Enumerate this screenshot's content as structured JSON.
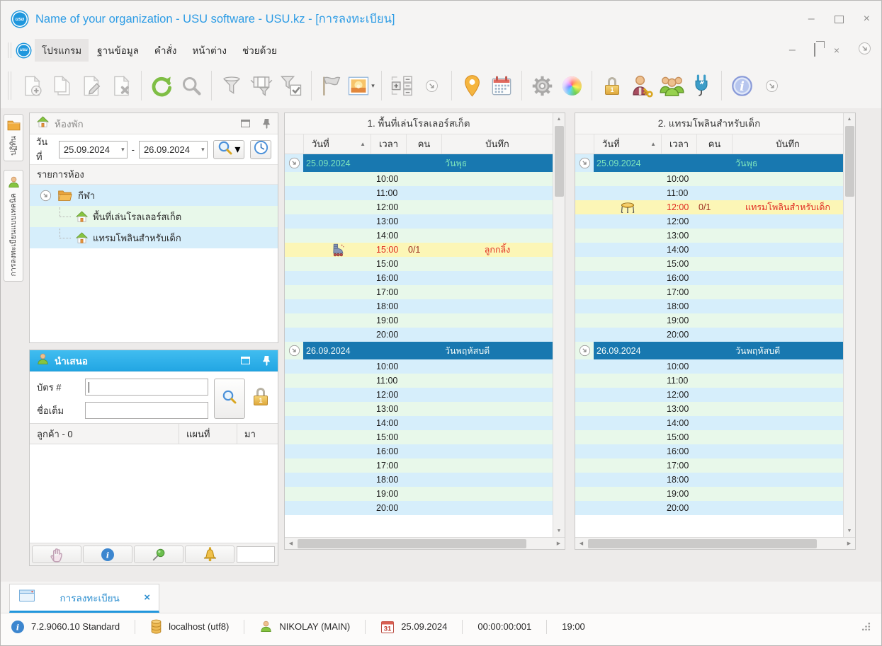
{
  "colors": {
    "accent_blue": "#2d9ce5",
    "group_header_blue": "#1878b0",
    "group1_text": "#7de4bc",
    "group2_text": "#f2fbf8",
    "booked_yellow": "#fcf6b6",
    "booked_red": "#e02b20",
    "booked_capacity_red": "#9c2d20",
    "row_green": "#e8f8ea",
    "row_blue": "#d6eefb"
  },
  "window": {
    "title": "Name of your organization - USU software - USU.kz - [การลงทะเบียน]",
    "logo_text": "usu"
  },
  "menu": {
    "items": [
      "โปรแกรม",
      "ฐานข้อมูล",
      "คำสั่ง",
      "หน้าต่าง",
      "ช่วยด้วย"
    ],
    "active_item": "โปรแกรม"
  },
  "toolbar": {
    "groups": [
      [
        "new-record-icon",
        "copy-record-icon",
        "edit-record-icon",
        "delete-record-icon"
      ],
      [
        "refresh-icon",
        "search-icon"
      ],
      [
        "filter-icon",
        "filter-columns-icon",
        "filter-check-icon"
      ],
      [
        "flag-icon",
        "image-picker-icon"
      ],
      [
        "row-expand-icon",
        "overflow-chevron-icon"
      ],
      [
        "location-pin-icon",
        "calendar-icon"
      ],
      [
        "settings-gear-icon",
        "color-wheel-icon"
      ],
      [
        "lock-icon",
        "user-key-icon",
        "users-group-icon",
        "plug-icon"
      ],
      [
        "info-icon",
        "overflow-chevron-icon"
      ]
    ]
  },
  "side_tabs": [
    {
      "icon": "folder-icon",
      "label": "ปฏิทิน"
    },
    {
      "icon": "person-icon",
      "label": "การลงทะเบียนแบบเทคนิค"
    }
  ],
  "rooms_panel": {
    "title": "ห้องพัก",
    "date_label": "วันที่",
    "date_from": "25.09.2024",
    "date_to": "26.09.2024",
    "date_separator": "-",
    "list_header": "รายการห้อง",
    "tree": [
      {
        "label": "กีฬา",
        "icon": "folder-open-icon",
        "expander": true,
        "shade": "blue"
      },
      {
        "label": "พื้นที่เล่นโรลเลอร์สเก็ต",
        "icon": "home-icon",
        "shade": "green",
        "child": true
      },
      {
        "label": "แทรมโพลินสำหรับเด็ก",
        "icon": "home-icon",
        "shade": "blue",
        "child": true
      }
    ]
  },
  "present_panel": {
    "title": "นำเสนอ",
    "fields": [
      {
        "label": "บัตร #",
        "value": ""
      },
      {
        "label": "ชื่อเต็ม",
        "value": ""
      }
    ],
    "table_headers": [
      "ลูกค้า - 0",
      "แผนที่",
      "มา"
    ],
    "footer_buttons": [
      "hand-icon",
      "info-blue-icon",
      "pushpin-icon",
      "bell-icon"
    ]
  },
  "schedules": [
    {
      "title": "1. พื้นที่เล่นโรลเลอร์สเก็ต",
      "columns": [
        "วันที่",
        "เวลา",
        "คน",
        "บันทึก"
      ],
      "groups": [
        {
          "date": "25.09.2024",
          "day": "วันพุธ",
          "text_color": "#7de4bc",
          "gutter_shade": "blue",
          "rows": [
            {
              "time": "10:00",
              "shade": "green"
            },
            {
              "time": "11:00",
              "shade": "blue"
            },
            {
              "time": "12:00",
              "shade": "green"
            },
            {
              "time": "13:00",
              "shade": "blue"
            },
            {
              "time": "14:00",
              "shade": "green"
            },
            {
              "time": "15:00",
              "people": "0/1",
              "note": "ลูกกลิ้ง",
              "booked": true,
              "icon": "roller-skate-icon"
            },
            {
              "time": "15:00",
              "shade": "green"
            },
            {
              "time": "16:00",
              "shade": "blue"
            },
            {
              "time": "17:00",
              "shade": "green"
            },
            {
              "time": "18:00",
              "shade": "blue"
            },
            {
              "time": "19:00",
              "shade": "green"
            },
            {
              "time": "20:00",
              "shade": "blue"
            }
          ]
        },
        {
          "date": "26.09.2024",
          "day": "วันพฤหัสบดี",
          "text_color": "#f2fbf8",
          "gutter_shade": "green",
          "rows": [
            {
              "time": "10:00",
              "shade": "blue"
            },
            {
              "time": "11:00",
              "shade": "green"
            },
            {
              "time": "12:00",
              "shade": "blue"
            },
            {
              "time": "13:00",
              "shade": "green"
            },
            {
              "time": "14:00",
              "shade": "blue"
            },
            {
              "time": "15:00",
              "shade": "green"
            },
            {
              "time": "16:00",
              "shade": "blue"
            },
            {
              "time": "17:00",
              "shade": "green"
            },
            {
              "time": "18:00",
              "shade": "blue"
            },
            {
              "time": "19:00",
              "shade": "green"
            },
            {
              "time": "20:00",
              "shade": "blue"
            }
          ]
        }
      ]
    },
    {
      "title": "2. แทรมโพลินสำหรับเด็ก",
      "columns": [
        "วันที่",
        "เวลา",
        "คน",
        "บันทึก"
      ],
      "groups": [
        {
          "date": "25.09.2024",
          "day": "วันพุธ",
          "text_color": "#7de4bc",
          "gutter_shade": "blue",
          "rows": [
            {
              "time": "10:00",
              "shade": "green"
            },
            {
              "time": "11:00",
              "shade": "blue"
            },
            {
              "time": "12:00",
              "people": "0/1",
              "note": "แทรมโพลินสำหรับเด็ก",
              "booked": true,
              "icon": "trampoline-icon"
            },
            {
              "time": "12:00",
              "shade": "blue"
            },
            {
              "time": "13:00",
              "shade": "green"
            },
            {
              "time": "14:00",
              "shade": "blue"
            },
            {
              "time": "15:00",
              "shade": "green"
            },
            {
              "time": "16:00",
              "shade": "blue"
            },
            {
              "time": "17:00",
              "shade": "green"
            },
            {
              "time": "18:00",
              "shade": "blue"
            },
            {
              "time": "19:00",
              "shade": "green"
            },
            {
              "time": "20:00",
              "shade": "blue"
            }
          ]
        },
        {
          "date": "26.09.2024",
          "day": "วันพฤหัสบดี",
          "text_color": "#f2fbf8",
          "gutter_shade": "green",
          "rows": [
            {
              "time": "10:00",
              "shade": "blue"
            },
            {
              "time": "11:00",
              "shade": "green"
            },
            {
              "time": "12:00",
              "shade": "blue"
            },
            {
              "time": "13:00",
              "shade": "green"
            },
            {
              "time": "14:00",
              "shade": "blue"
            },
            {
              "time": "15:00",
              "shade": "green"
            },
            {
              "time": "16:00",
              "shade": "blue"
            },
            {
              "time": "17:00",
              "shade": "green"
            },
            {
              "time": "18:00",
              "shade": "blue"
            },
            {
              "time": "19:00",
              "shade": "green"
            },
            {
              "time": "20:00",
              "shade": "blue"
            }
          ]
        }
      ]
    }
  ],
  "doc_tab": {
    "label": "การลงทะเบียน",
    "close": "×"
  },
  "status_bar": {
    "items": [
      {
        "icon": "info-blue-icon",
        "text": "7.2.9060.10 Standard"
      },
      {
        "icon": "database-icon",
        "text": "localhost (utf8)"
      },
      {
        "icon": "user-icon",
        "text": "NIKOLAY (MAIN)"
      },
      {
        "icon": "calendar-31-icon",
        "text": "25.09.2024"
      },
      {
        "text": "00:00:00:001"
      },
      {
        "text": "19:00"
      }
    ],
    "calendar_day": "31"
  }
}
